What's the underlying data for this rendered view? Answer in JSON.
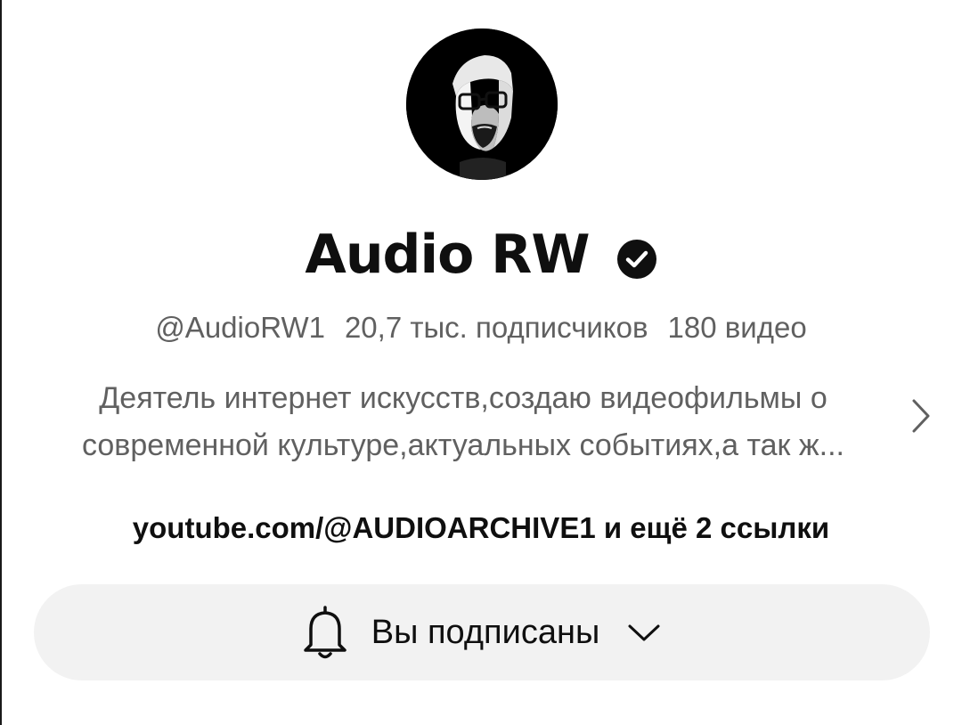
{
  "channel": {
    "name": "Audio RW",
    "handle": "@AudioRW1",
    "subscribers": "20,7 тыс. подписчиков",
    "videos": "180 видео",
    "description": "Деятель интернет искусств,создаю видеофильмы о современной культуре,актуальных событиях,а так ж...",
    "links": "youtube.com/@AUDIOARCHIVE1 и ещё 2 ссылки"
  },
  "subscribe_button": {
    "label": "Вы подписаны"
  },
  "icons": {
    "verified": "verified-check-icon",
    "description_more": "chevron-right-icon",
    "bell": "bell-icon",
    "dropdown": "chevron-down-icon"
  },
  "colors": {
    "text_primary": "#0f0f0f",
    "text_secondary": "#606060",
    "button_bg": "#f2f2f2"
  }
}
